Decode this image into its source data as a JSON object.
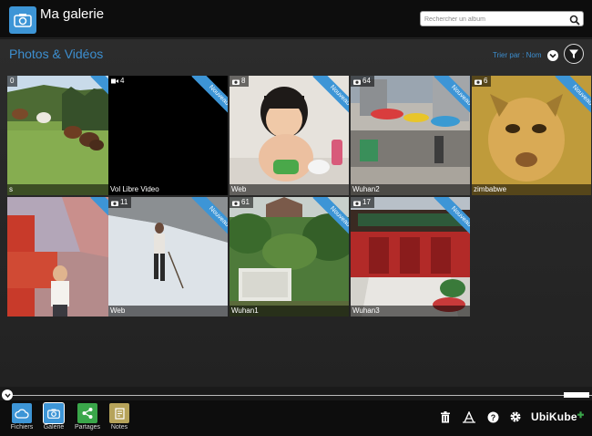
{
  "header": {
    "app_title": "Ma galerie",
    "search_placeholder": "Rechercher un album"
  },
  "toolbar": {
    "section_title": "Photos & Vidéos",
    "sort_label": "Trier par : Nom"
  },
  "gallery": {
    "ribbon_label": "Nouveau",
    "items": [
      {
        "count": "0",
        "media": "photo",
        "caption": "s"
      },
      {
        "count": "4",
        "media": "video",
        "caption": "Vol Libre Video"
      },
      {
        "count": "8",
        "media": "photo",
        "caption": "Web"
      },
      {
        "count": "64",
        "media": "photo",
        "caption": "Wuhan2"
      },
      {
        "count": "6",
        "media": "photo",
        "caption": "zimbabwe"
      },
      {
        "count": "",
        "media": "photo",
        "caption": ""
      },
      {
        "count": "11",
        "media": "photo",
        "caption": "Web"
      },
      {
        "count": "61",
        "media": "photo",
        "caption": "Wuhan1"
      },
      {
        "count": "17",
        "media": "photo",
        "caption": "Wuhan3"
      }
    ]
  },
  "bottom_nav": {
    "items": [
      {
        "label": "Fichiers",
        "icon": "cloud-icon",
        "color": "#3d95d6"
      },
      {
        "label": "Galerie",
        "icon": "camera-icon",
        "color": "#3d95d6"
      },
      {
        "label": "Partages",
        "icon": "share-icon",
        "color": "#3aa64a"
      },
      {
        "label": "Notes",
        "icon": "note-icon",
        "color": "#b6a35a"
      }
    ]
  },
  "tools": {
    "icons": [
      "trash-icon",
      "font-icon",
      "help-icon",
      "gear-icon"
    ]
  },
  "brand": {
    "name": "UbiKube"
  },
  "colors": {
    "accent": "#3d95d6",
    "background": "#2a2a2a",
    "bar": "#0d0d0d"
  }
}
